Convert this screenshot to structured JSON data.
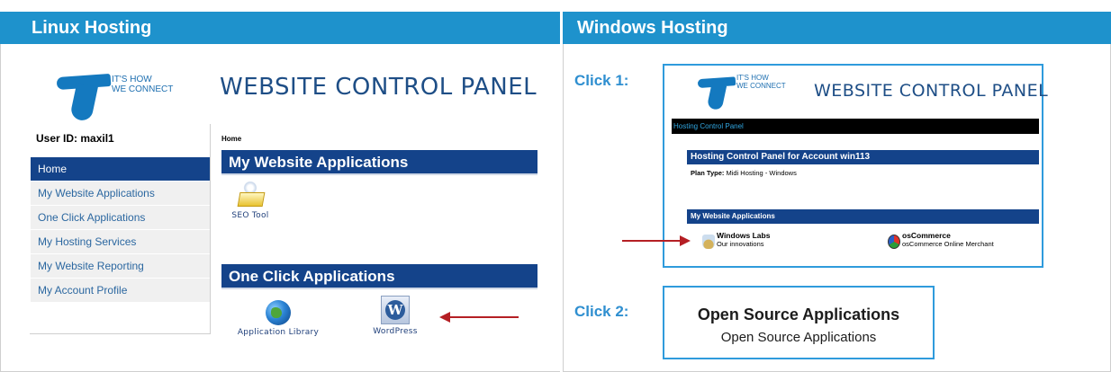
{
  "linux": {
    "header": "Linux Hosting",
    "logo_tagline": "IT'S HOW\nWE CONNECT",
    "panel_title": "WEBSITE CONTROL PANEL",
    "user_id": "User ID: maxil1",
    "nav": [
      {
        "label": "Home",
        "active": true
      },
      {
        "label": "My Website Applications"
      },
      {
        "label": "One Click Applications"
      },
      {
        "label": "My Hosting Services"
      },
      {
        "label": "My Website Reporting"
      },
      {
        "label": "My Account Profile"
      }
    ],
    "breadcrumb": "Home",
    "section1_title": "My Website Applications",
    "seo_tool_label": "SEO Tool",
    "section2_title": "One Click Applications",
    "app_library_label": "Application Library",
    "wordpress_label": "WordPress"
  },
  "windows": {
    "header": "Windows Hosting",
    "click1_label": "Click 1:",
    "click2_label": "Click 2:",
    "shot1": {
      "logo_tagline": "IT'S HOW\nWE CONNECT",
      "panel_title": "WEBSITE CONTROL PANEL",
      "hcp_bar": "Hosting Control Panel",
      "account_title": "Hosting Control Panel for Account win113",
      "plan_label": "Plan Type:",
      "plan_value": "Midi Hosting - Windows",
      "apps_title": "My Website Applications",
      "apps": [
        {
          "title": "Windows Labs",
          "desc": "Our innovations",
          "icon": "windows-labs-icon"
        },
        {
          "title": "osCommerce",
          "desc": "osCommerce Online Merchant",
          "icon": "oscommerce-icon"
        }
      ]
    },
    "shot2": {
      "title": "Open Source Applications",
      "subtitle": "Open Source Applications"
    }
  },
  "colors": {
    "header_blue": "#1e92cc",
    "nav_active": "#14438a",
    "arrow_red": "#b51f24",
    "click_label": "#2f8fd0"
  }
}
